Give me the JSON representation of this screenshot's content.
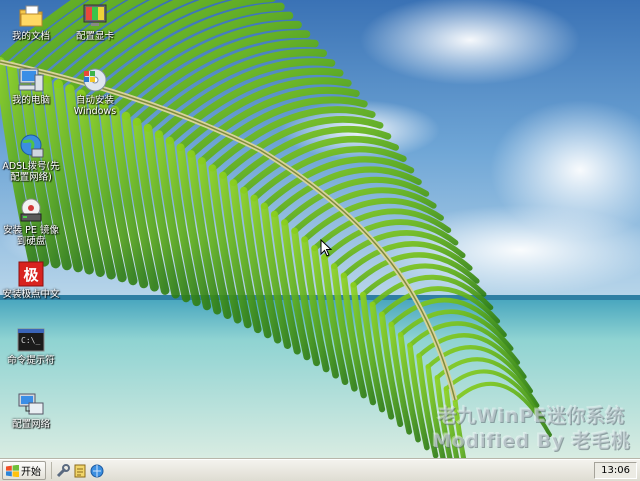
{
  "desktop": {
    "icons": [
      {
        "label": "我的文档",
        "icon": "my-documents-icon"
      },
      {
        "label": "配置显卡",
        "icon": "display-settings-icon"
      },
      {
        "label": "我的电脑",
        "icon": "my-computer-icon"
      },
      {
        "label": "自动安装\nWindows",
        "icon": "windows-setup-cd-icon"
      },
      {
        "label": "ADSL拨号(先\n配置网络)",
        "icon": "network-globe-icon"
      },
      {
        "label": "安装 PE 镜像\n到硬盘",
        "icon": "disk-install-icon"
      },
      {
        "label": "安装极点中文",
        "icon": "chinese-input-icon"
      },
      {
        "label": "命令提示符",
        "icon": "command-prompt-icon"
      },
      {
        "label": "配置网络",
        "icon": "network-config-icon"
      }
    ],
    "watermark": [
      "老九WinPE迷你系统",
      "Modified By 老毛桃"
    ]
  },
  "taskbar": {
    "start_label": "开始",
    "quick_launch": [
      "tool-icon",
      "notepad-icon",
      "browser-icon"
    ],
    "clock": "13:06"
  }
}
